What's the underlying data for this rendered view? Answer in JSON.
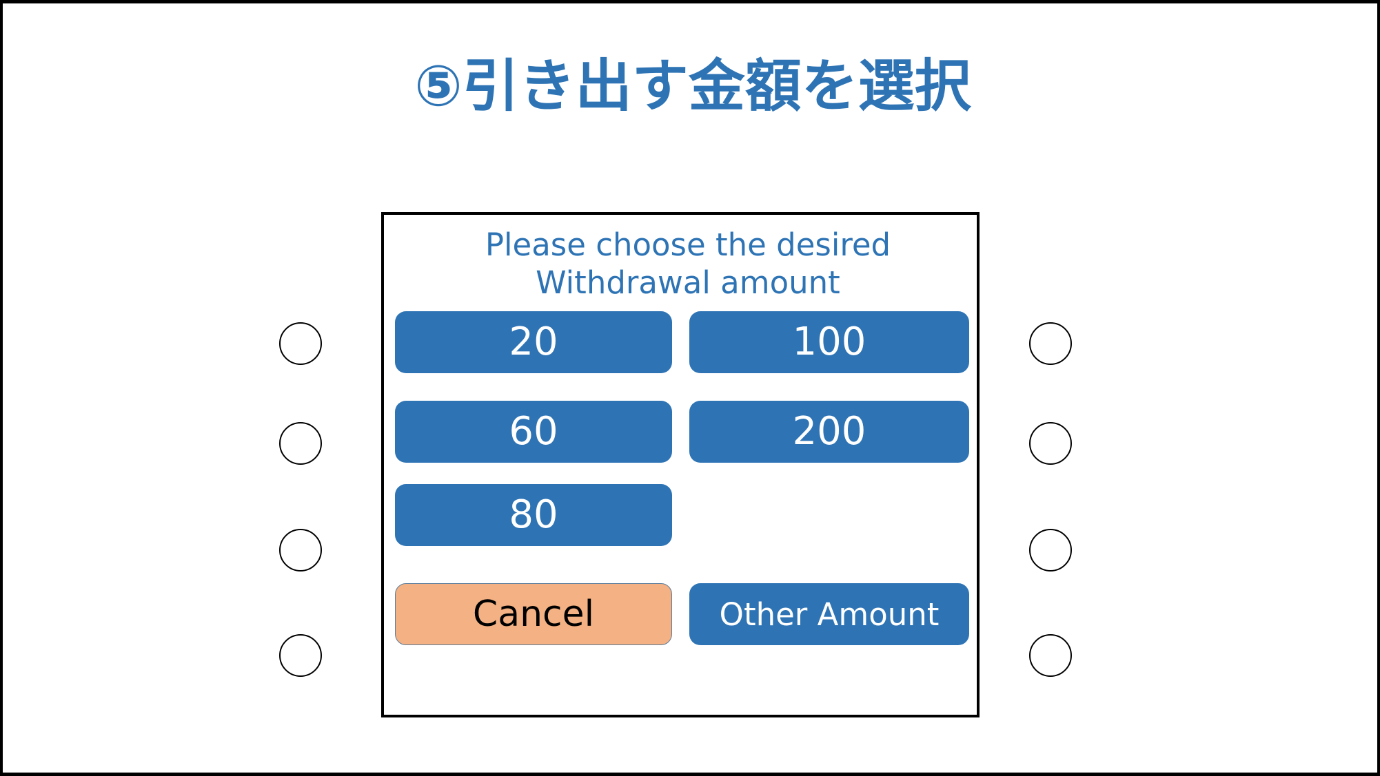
{
  "slide": {
    "title": "⑤引き出す金額を選択",
    "title_color": "#2E74B5",
    "background_color": "#FFFFFF"
  },
  "atm": {
    "prompt_line1": "Please choose the desired",
    "prompt_line2": "Withdrawal amount",
    "prompt_color": "#2E74B5",
    "panel_border_color": "#000000",
    "amount_button_color": "#2E74B5",
    "amount_button_text_color": "#FFFFFF",
    "cancel_button_color": "#F4B183",
    "cancel_button_text_color": "#000000",
    "buttons": {
      "left_column": [
        {
          "label": "20"
        },
        {
          "label": "60"
        },
        {
          "label": "80"
        }
      ],
      "right_column": [
        {
          "label": "100"
        },
        {
          "label": "200"
        }
      ],
      "cancel": "Cancel",
      "other_amount": "Other Amount"
    },
    "side_buttons": {
      "left_count": 4,
      "right_count": 4
    }
  }
}
